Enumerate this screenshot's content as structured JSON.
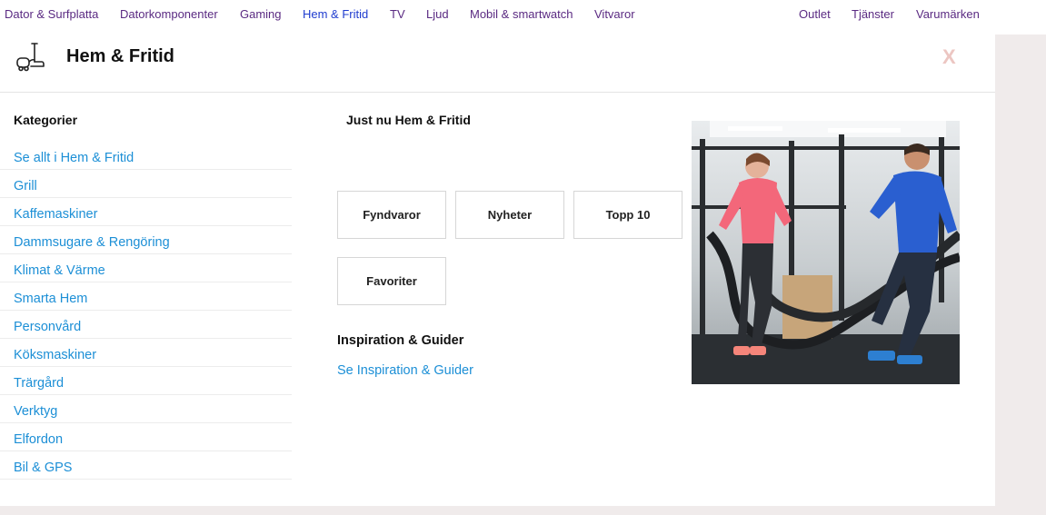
{
  "topnav": {
    "items": [
      {
        "label": "Dator & Surfplatta"
      },
      {
        "label": "Datorkomponenter"
      },
      {
        "label": "Gaming"
      },
      {
        "label": "Hem & Fritid"
      },
      {
        "label": "TV"
      },
      {
        "label": "Ljud"
      },
      {
        "label": "Mobil & smartwatch"
      },
      {
        "label": "Vitvaror"
      }
    ],
    "right_items": [
      {
        "label": "Outlet"
      },
      {
        "label": "Tjänster"
      },
      {
        "label": "Varumärken"
      }
    ],
    "active": "Hem & Fritid"
  },
  "panel": {
    "title": "Hem & Fritid",
    "icon": "vacuum-cleaner-icon",
    "close_label": "X"
  },
  "categories": {
    "heading": "Kategorier",
    "items": [
      {
        "label": "Se allt i Hem & Fritid"
      },
      {
        "label": "Grill"
      },
      {
        "label": "Kaffemaskiner"
      },
      {
        "label": "Dammsugare & Rengöring"
      },
      {
        "label": "Klimat & Värme"
      },
      {
        "label": "Smarta Hem"
      },
      {
        "label": "Personvård"
      },
      {
        "label": "Köksmaskiner"
      },
      {
        "label": "Trärgård"
      },
      {
        "label": "Verktyg"
      },
      {
        "label": "Elfordon"
      },
      {
        "label": "Bil & GPS"
      }
    ]
  },
  "just_now": {
    "heading": "Just nu Hem & Fritid",
    "tiles": [
      {
        "label": "Fyndvaror"
      },
      {
        "label": "Nyheter"
      },
      {
        "label": "Topp 10"
      },
      {
        "label": "Favoriter"
      }
    ]
  },
  "inspiration": {
    "heading": "Inspiration & Guider",
    "link": "Se Inspiration & Guider"
  },
  "colors": {
    "link": "#1c8fd6",
    "nav": "#5a2a82",
    "nav_active": "#1f3ccf",
    "close": "#ecc6c2",
    "backdrop": "#f0ebeb"
  }
}
